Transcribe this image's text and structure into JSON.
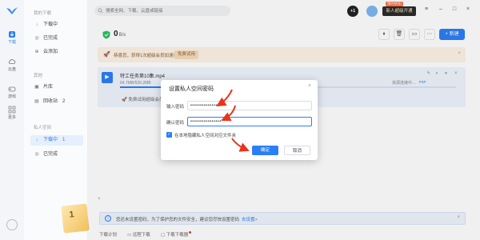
{
  "rail": {
    "items": [
      {
        "label": "下载",
        "icon": "download-icon",
        "active": true
      },
      {
        "label": "云盘",
        "icon": "cloud-icon",
        "active": false
      },
      {
        "label": "游戏",
        "icon": "gamepad-icon",
        "active": false
      },
      {
        "label": "更多",
        "icon": "grid-icon",
        "active": false
      }
    ]
  },
  "sidebar": {
    "section_mine": "我的下载",
    "downloading": "下载中",
    "completed": "已完成",
    "cloud_add": "云添加",
    "section_other": "其他",
    "library": "片库",
    "recycle": "回收站",
    "recycle_count": "2",
    "section_private": "私人空间",
    "private_downloading": "下载中",
    "private_downloading_count": "1",
    "private_completed": "已完成",
    "card_number": "1"
  },
  "topbar": {
    "search_placeholder": "搜索全网、下载、云盘或链接",
    "plus_badge": "+1",
    "vip_tag": "限时折扣",
    "vip_button": "新人超级开通"
  },
  "toolbar": {
    "speed_value": "0",
    "speed_unit": "B/s",
    "new_button": "+ 新建",
    "pause_icon": "pause-icon",
    "delete_icon": "trash-icon",
    "folder_icon": "folder-icon",
    "more_icon": "more-icon"
  },
  "promo": {
    "text": "恭喜您，获得1次超级会员加速试用机会！",
    "button": "免费试用"
  },
  "task": {
    "name": "特工任务第10集.mp4",
    "size": "64.7MB/526.2MB",
    "progress": 0.123,
    "speed_tip": "资源连接中...",
    "p2p": "P2P",
    "perk": "免费试用超级会员"
  },
  "modal": {
    "title": "设置私人空间密码",
    "label_password": "输入密码",
    "label_confirm": "确认密码",
    "password_value": "••••••••••••••••",
    "confirm_value": "••••••••••••••••",
    "checkbox_label": "在本地隐藏私人空间对应文件夹",
    "checkbox_checked": true,
    "ok_button": "确定",
    "cancel_button": "取消"
  },
  "notice": {
    "text": "您还未设置密码，为了保护您的文件安全，建议您尽快设置密码",
    "link": "去设置>"
  },
  "footer": {
    "items": [
      "下载计划",
      "远程下载",
      "下载下载器"
    ]
  },
  "colors": {
    "accent": "#2b7ff5",
    "annotation": "#e8341c"
  }
}
